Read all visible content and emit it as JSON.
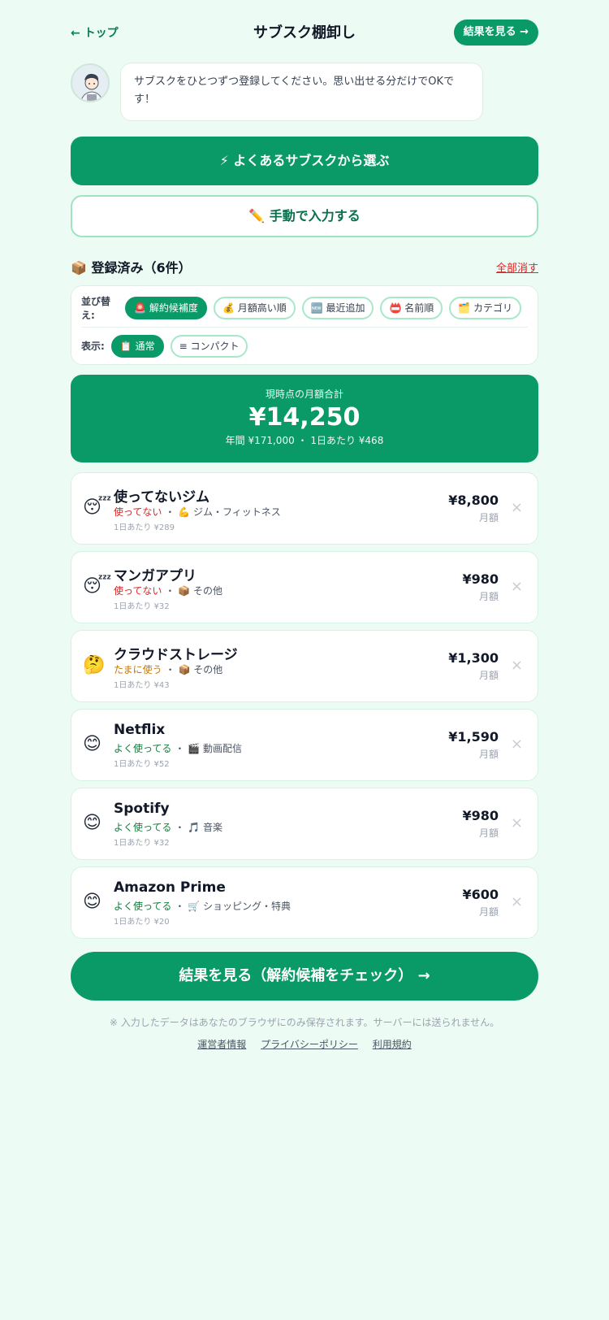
{
  "header": {
    "back_label": "← トップ",
    "title": "サブスク棚卸し",
    "result_button": "結果を見る →"
  },
  "intro": {
    "message": "サブスクをひとつずつ登録してください。思い出せる分だけでOKです！"
  },
  "actions": {
    "pick_popular": "⚡ よくあるサブスクから選ぶ",
    "manual_input": "✏️ 手動で入力する"
  },
  "registered": {
    "title": "📦 登録済み（6件）",
    "clear_all": "全部消す"
  },
  "sort": {
    "label": "並び替え:",
    "options": [
      {
        "label": "🚨 解約候補度",
        "active": true
      },
      {
        "label": "💰 月額高い順",
        "active": false
      },
      {
        "label": "🆕 最近追加",
        "active": false
      },
      {
        "label": "📛 名前順",
        "active": false
      },
      {
        "label": "🗂️ カテゴリ",
        "active": false
      }
    ]
  },
  "view": {
    "label": "表示:",
    "options": [
      {
        "label": "📋 通常",
        "active": true
      },
      {
        "label": "≡ コンパクト",
        "active": false
      }
    ]
  },
  "total": {
    "label": "現時点の月額合計",
    "amount": "¥14,250",
    "sub": "年間 ¥171,000 ・ 1日あたり ¥468"
  },
  "items": [
    {
      "emoji": "😴",
      "name": "使ってないジム",
      "usage": "使ってない",
      "usage_color": "#dc2626",
      "category": "・ 💪 ジム・フィットネス",
      "daily": "1日あたり ¥289",
      "price": "¥8,800",
      "unit": "月額",
      "remove": "×"
    },
    {
      "emoji": "😴",
      "name": "マンガアプリ",
      "usage": "使ってない",
      "usage_color": "#dc2626",
      "category": "・ 📦 その他",
      "daily": "1日あたり ¥32",
      "price": "¥980",
      "unit": "月額",
      "remove": "×"
    },
    {
      "emoji": "🤔",
      "name": "クラウドストレージ",
      "usage": "たまに使う",
      "usage_color": "#c2770c",
      "category": "・ 📦 その他",
      "daily": "1日あたり ¥43",
      "price": "¥1,300",
      "unit": "月額",
      "remove": "×"
    },
    {
      "emoji": "😊",
      "name": "Netflix",
      "usage": "よく使ってる",
      "usage_color": "#15803d",
      "category": "・ 🎬 動画配信",
      "daily": "1日あたり ¥52",
      "price": "¥1,590",
      "unit": "月額",
      "remove": "×"
    },
    {
      "emoji": "😊",
      "name": "Spotify",
      "usage": "よく使ってる",
      "usage_color": "#15803d",
      "category": "・ 🎵 音楽",
      "daily": "1日あたり ¥32",
      "price": "¥980",
      "unit": "月額",
      "remove": "×"
    },
    {
      "emoji": "😊",
      "name": "Amazon Prime",
      "usage": "よく使ってる",
      "usage_color": "#15803d",
      "category": "・ 🛒 ショッピング・特典",
      "daily": "1日あたり ¥20",
      "price": "¥600",
      "unit": "月額",
      "remove": "×"
    }
  ],
  "cta": {
    "label": "結果を見る（解約候補をチェック） →"
  },
  "footer": {
    "note": "※ 入力したデータはあなたのブラウザにのみ保存されます。サーバーには送られません。",
    "links": [
      "運営者情報",
      "プライバシーポリシー",
      "利用規約"
    ]
  },
  "colors": {
    "accent": "#0a9a68",
    "background": "#ecfbf3"
  }
}
